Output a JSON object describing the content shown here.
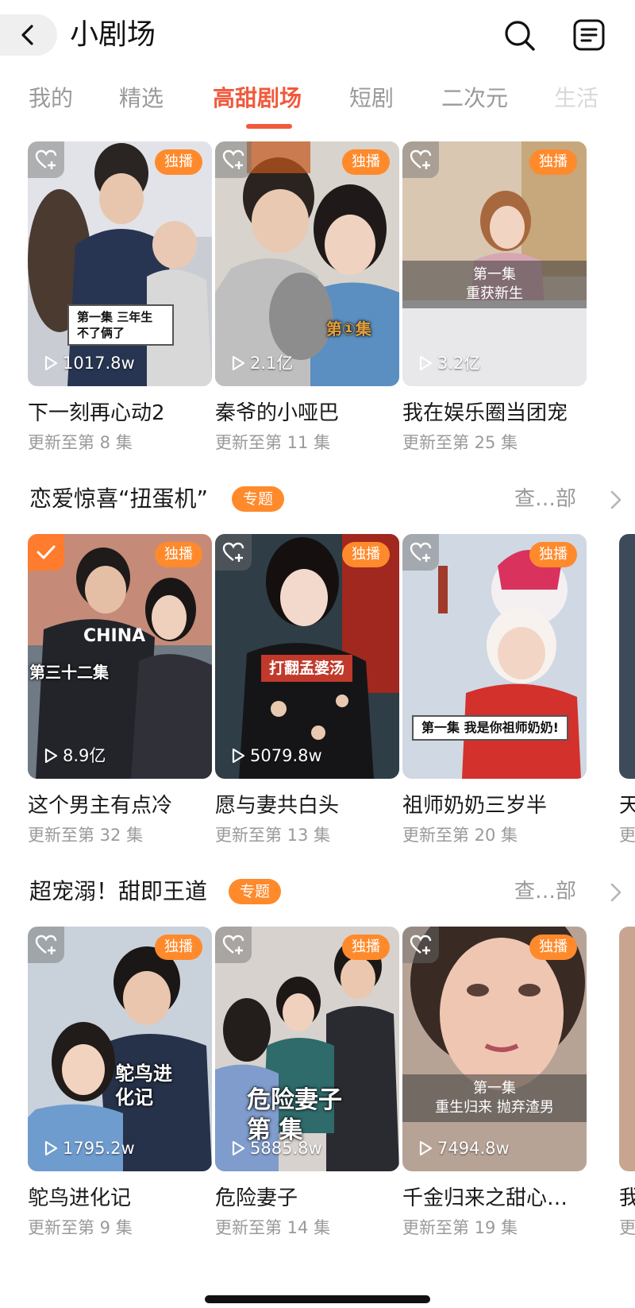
{
  "header": {
    "title": "小剧场"
  },
  "tabs": [
    {
      "label": "我的"
    },
    {
      "label": "精选"
    },
    {
      "label": "高甜剧场"
    },
    {
      "label": "短剧"
    },
    {
      "label": "二次元"
    },
    {
      "label": "生活"
    }
  ],
  "colors": {
    "accent": "#f05a3c",
    "badge": "#ff8a2c"
  },
  "row1": [
    {
      "title": "下一刻再心动2",
      "subtitle": "更新至第 8 集",
      "plays": "1017.8w",
      "badge": "独播",
      "overlay": "第一集 三年生不了俩了"
    },
    {
      "title": "秦爷的小哑巴",
      "subtitle": "更新至第 11 集",
      "plays": "2.1亿",
      "badge": "独播",
      "overlay": "第①集"
    },
    {
      "title": "我在娱乐圈当团宠",
      "subtitle": "更新至第 25 集",
      "plays": "3.2亿",
      "badge": "独播",
      "overlay_line1": "第一集",
      "overlay_line2": "重获新生"
    }
  ],
  "section2": {
    "title": "恋爱惊喜“扭蛋机”",
    "tag": "专题",
    "see_all": "查…部",
    "cards": [
      {
        "title": "这个男主有点冷",
        "subtitle": "更新至第 32 集",
        "plays": "8.9亿",
        "badge": "独播",
        "overlay": "第三十二集"
      },
      {
        "title": "愿与妻共白头",
        "subtitle": "更新至第 13 集",
        "plays": "5079.8w",
        "badge": "独播",
        "overlay": "打翻孟婆汤"
      },
      {
        "title": "祖师奶奶三岁半",
        "subtitle": "更新至第 20 集",
        "plays": "",
        "badge": "独播",
        "overlay": "第一集 我是你祖师奶奶!"
      }
    ],
    "peek_title": "天",
    "peek_sub": "更"
  },
  "section3": {
    "title": "超宠溺！甜即王道",
    "tag": "专题",
    "see_all": "查…部",
    "cards": [
      {
        "title": "鸵鸟进化记",
        "subtitle": "更新至第 9 集",
        "plays": "1795.2w",
        "badge": "独播",
        "overlay": "鸵鸟进化记"
      },
      {
        "title": "危险妻子",
        "subtitle": "更新至第 14 集",
        "plays": "5885.8w",
        "badge": "独播",
        "overlay": "危险妻子 第 集"
      },
      {
        "title": "千金归来之甜心…",
        "subtitle": "更新至第 19 集",
        "plays": "7494.8w",
        "badge": "独播",
        "overlay_line1": "第一集",
        "overlay_line2": "重生归来 抛弃渣男"
      }
    ],
    "peek_title": "我",
    "peek_sub": "更"
  }
}
